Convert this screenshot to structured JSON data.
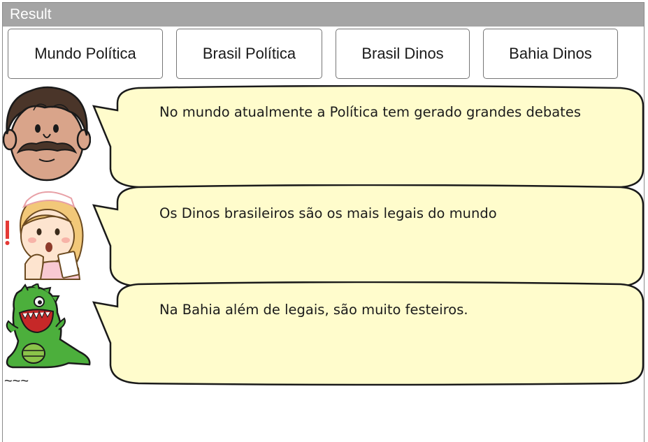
{
  "window": {
    "title": "Result"
  },
  "buttons": [
    "Mundo Política",
    "Brasil Política",
    "Brasil Dinos",
    "Bahia Dinos"
  ],
  "dialogs": [
    {
      "character": "man-with-mustache",
      "text": "No mundo atualmente a Política tem gerado grandes debates"
    },
    {
      "character": "surprised-nurse",
      "text": "Os Dinos brasileiros são os mais legais do mundo"
    },
    {
      "character": "green-dinosaur",
      "text": "Na Bahia além de legais, são muito festeiros."
    }
  ],
  "footer": {
    "text": "~~~"
  },
  "colors": {
    "header": "#a5a5a5",
    "bubble_fill": "#fffccc",
    "dino": "#4caf3c"
  }
}
